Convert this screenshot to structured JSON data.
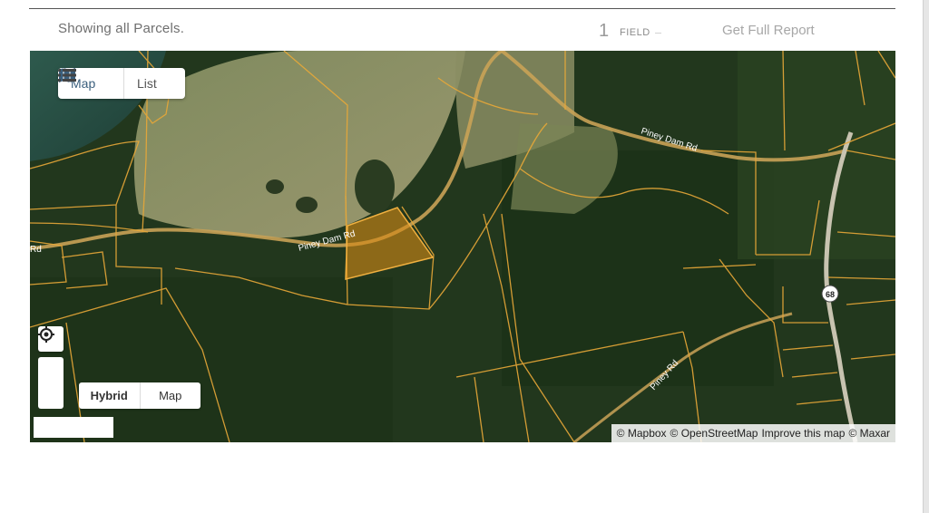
{
  "header": {
    "showing_text": "Showing all Parcels.",
    "field_count": "1",
    "field_label": "FIELD",
    "report_link": "Get Full Report"
  },
  "map_controls": {
    "view_toggle": {
      "map_label": "Map",
      "list_label": "List",
      "active": "Map"
    },
    "style_toggle": {
      "hybrid_label": "Hybrid",
      "map_label": "Map",
      "active": "Hybrid"
    }
  },
  "map_labels": {
    "road_1": "Piney Dam Rd",
    "road_2": "Piney Dam Rd",
    "road_3": "Piney Rd",
    "route_shield": "68",
    "road_edge": "Rd"
  },
  "attribution": {
    "mapbox": "© Mapbox",
    "osm": "© OpenStreetMap",
    "improve": "Improve this map",
    "maxar": "© Maxar"
  },
  "colors": {
    "parcel_line": "#e8a838",
    "selected_parcel": "#d68a16",
    "road": "#c9a257",
    "accent_icon": "#3a5f7d"
  }
}
